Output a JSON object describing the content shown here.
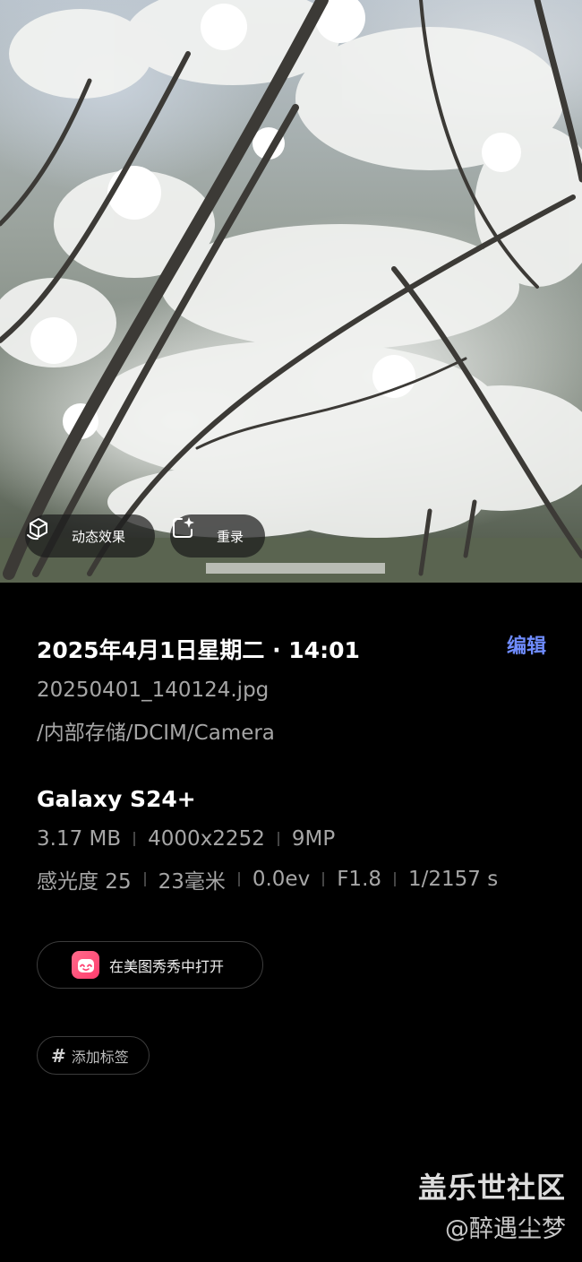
{
  "photo": {
    "effects_button": "动态效果",
    "remaster_button": "重录"
  },
  "details": {
    "datetime": "2025年4月1日星期二 · 14:01",
    "edit_label": "编辑",
    "filename": "20250401_140124.jpg",
    "path": "/内部存储/DCIM/Camera",
    "device": "Galaxy S24+",
    "specs_row1": [
      "3.17 MB",
      "4000x2252",
      "9MP"
    ],
    "specs_row2": [
      "感光度 25",
      "23毫米",
      "0.0ev",
      "F1.8",
      "1/2157 s"
    ]
  },
  "actions": {
    "open_in_app": "在美图秀秀中打开",
    "add_tag": "添加标签"
  },
  "watermark": {
    "title": "盖乐世社区",
    "user": "@醉遇尘梦"
  },
  "colors": {
    "accent": "#6f8cff",
    "background": "#000000",
    "secondary_text": "#a6a6a6",
    "app_logo": "#ff4f78"
  },
  "icons": {
    "effects": "cube-motion-icon",
    "remaster": "sparkle-frame-icon",
    "app": "meitu-logo-icon",
    "tag": "hash-icon"
  }
}
